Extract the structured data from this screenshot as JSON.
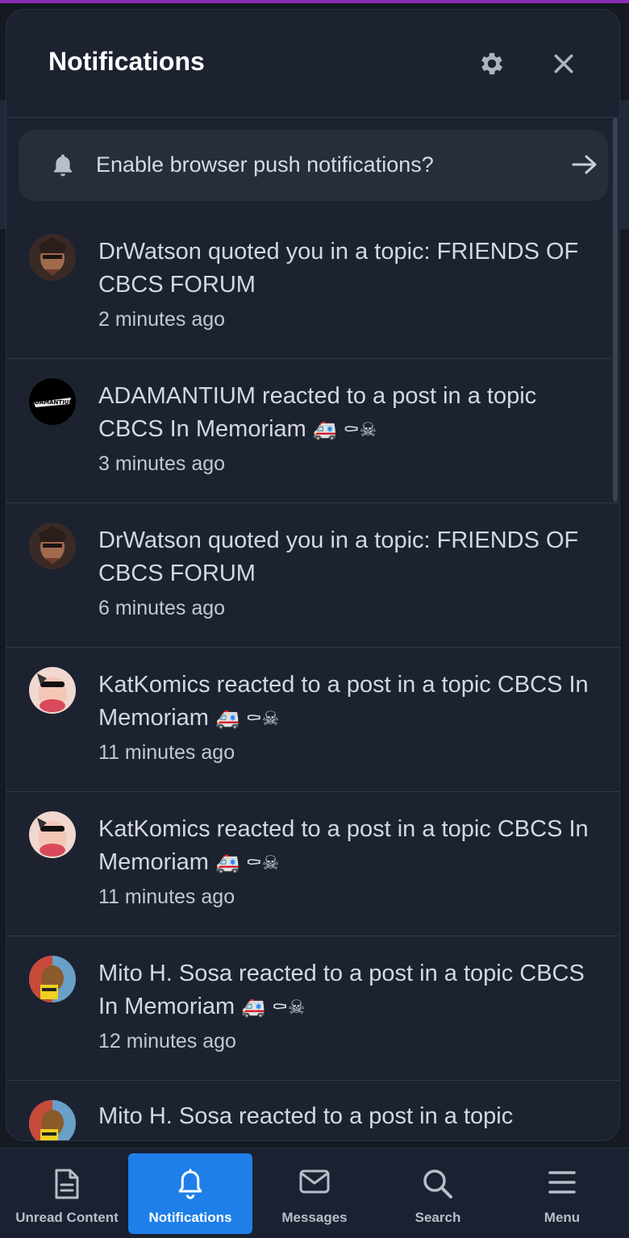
{
  "panel": {
    "title": "Notifications",
    "settings_icon": "gear-icon",
    "close_icon": "close-icon"
  },
  "push_banner": {
    "text": "Enable browser push notifications?",
    "icon": "bell-icon",
    "action_icon": "arrow-right-icon"
  },
  "notifications": [
    {
      "user": "DrWatson",
      "text": "DrWatson quoted you in a topic: FRIENDS OF CBCS FORUM",
      "emoji": "",
      "time": "2 minutes ago"
    },
    {
      "user": "ADAMANTIUM",
      "text": "ADAMANTIUM reacted to a post in a topic CBCS In Memoriam",
      "emoji": "🚑 ⚰☠",
      "time": "3 minutes ago"
    },
    {
      "user": "DrWatson",
      "text": "DrWatson quoted you in a topic: FRIENDS OF CBCS FORUM",
      "emoji": "",
      "time": "6 minutes ago"
    },
    {
      "user": "KatKomics",
      "text": "KatKomics reacted to a post in a topic CBCS In Memoriam",
      "emoji": "🚑 ⚰☠",
      "time": "11 minutes ago"
    },
    {
      "user": "KatKomics",
      "text": "KatKomics reacted to a post in a topic CBCS In Memoriam",
      "emoji": "🚑 ⚰☠",
      "time": "11 minutes ago"
    },
    {
      "user": "Mito H. Sosa",
      "text": "Mito H. Sosa reacted to a post in a topic CBCS In Memoriam",
      "emoji": "🚑 ⚰☠",
      "time": "12 minutes ago"
    },
    {
      "user": "Mito H. Sosa",
      "text": "Mito H. Sosa reacted to a post in a topic",
      "emoji": "",
      "time": ""
    }
  ],
  "bottom_nav": [
    {
      "label": "Unread Content",
      "icon": "document-icon",
      "active": false
    },
    {
      "label": "Notifications",
      "icon": "bell-icon",
      "active": true
    },
    {
      "label": "Messages",
      "icon": "envelope-icon",
      "active": false
    },
    {
      "label": "Search",
      "icon": "search-icon",
      "active": false
    },
    {
      "label": "Menu",
      "icon": "hamburger-menu-icon",
      "active": false
    }
  ],
  "colors": {
    "accent": "#1e7fe8",
    "panel_bg": "#1c2230",
    "top_bar": "#8a2bb8"
  }
}
